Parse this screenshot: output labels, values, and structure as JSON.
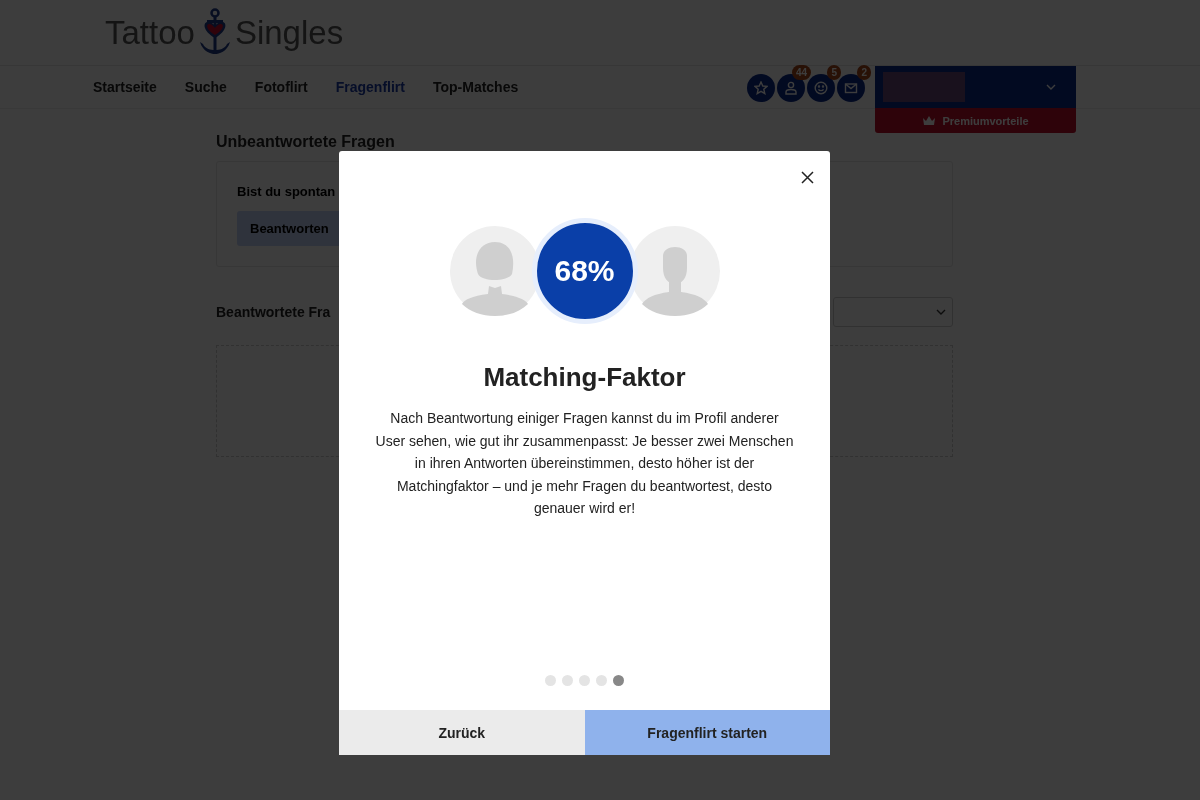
{
  "header": {
    "logo_left": "Tattoo",
    "logo_right": "Singles"
  },
  "nav": [
    {
      "label": "Startseite",
      "selected": false
    },
    {
      "label": "Suche",
      "selected": false
    },
    {
      "label": "Fotoflirt",
      "selected": false
    },
    {
      "label": "Fragenflirt",
      "selected": true
    },
    {
      "label": "Top-Matches",
      "selected": false
    }
  ],
  "header_icons": [
    {
      "kind": "star"
    },
    {
      "kind": "person",
      "badge": "44"
    },
    {
      "kind": "smiley",
      "badge": "5"
    },
    {
      "kind": "mail",
      "badge": "2"
    }
  ],
  "premium": {
    "label": "Premiumvorteile"
  },
  "page": {
    "unanswered_heading": "Unbeantwortete Fragen",
    "question": "Bist du spontan",
    "answer_button": "Beantworten",
    "answered_heading": "Beantwortete Fra"
  },
  "modal": {
    "match_percent": "68%",
    "title": "Matching-Faktor",
    "text": "Nach Beantwortung einiger Fragen kannst du im Profil anderer User sehen, wie gut ihr zusammenpasst: Je besser zwei Menschen in ihren Antworten übereinstimmen, desto höher ist der Matchingfaktor – und je mehr Fragen du beantwortest, desto genauer wird er!",
    "dots": [
      {
        "selected": false
      },
      {
        "selected": false
      },
      {
        "selected": false
      },
      {
        "selected": false
      },
      {
        "selected": true
      }
    ],
    "back_button": "Zurück",
    "start_button": "Fragenflirt starten"
  }
}
